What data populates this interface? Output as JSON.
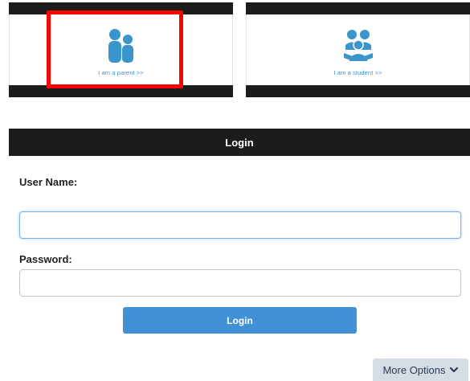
{
  "roles": {
    "parent": {
      "label": "I am a parent >>",
      "icon": "parent-users-icon"
    },
    "student": {
      "label": "I am a student >>",
      "icon": "student-group-icon"
    }
  },
  "login": {
    "header": "Login",
    "username_label": "User Name:",
    "username_value": "",
    "password_label": "Password:",
    "password_value": "",
    "button_label": "Login"
  },
  "more_options": {
    "label": "More Options",
    "icon": "chevron-down-icon"
  },
  "colors": {
    "header_bg": "#1c1c1c",
    "accent_blue": "#4290d6",
    "icon_blue": "#3a95cc",
    "highlight": "#ff0000"
  }
}
